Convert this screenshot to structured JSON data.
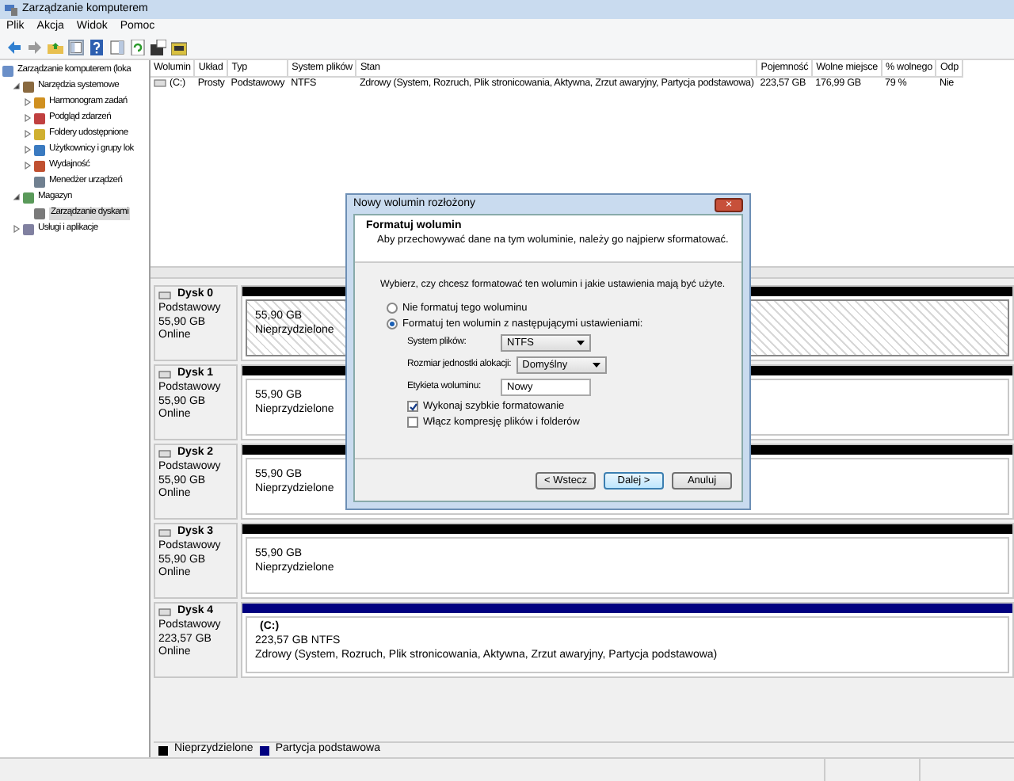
{
  "window": {
    "title": "Zarządzanie komputerem"
  },
  "menu": [
    "Plik",
    "Akcja",
    "Widok",
    "Pomoc"
  ],
  "tree": [
    {
      "label": "Zarządzanie komputerem (loka",
      "kind": "root",
      "selected": false,
      "children": [
        {
          "label": "Narzędzia systemowe",
          "kind": "branch",
          "expanded": true,
          "selected": false,
          "children": [
            {
              "label": "Harmonogram zadań",
              "kind": "branch",
              "expanded": false,
              "selected": false
            },
            {
              "label": "Podgląd zdarzeń",
              "kind": "branch",
              "expanded": false,
              "selected": false
            },
            {
              "label": "Foldery udostępnione",
              "kind": "branch",
              "expanded": false,
              "selected": false
            },
            {
              "label": "Użytkownicy i grupy lok",
              "kind": "branch",
              "expanded": false,
              "selected": false
            },
            {
              "label": "Wydajność",
              "kind": "branch",
              "expanded": false,
              "selected": false
            },
            {
              "label": "Menedżer urządzeń",
              "kind": "leaf",
              "selected": false
            }
          ]
        },
        {
          "label": "Magazyn",
          "kind": "branch",
          "expanded": true,
          "selected": false,
          "children": [
            {
              "label": "Zarządzanie dyskami",
              "kind": "leaf",
              "selected": true
            }
          ]
        },
        {
          "label": "Usługi i aplikacje",
          "kind": "branch",
          "expanded": false,
          "selected": false
        }
      ]
    }
  ],
  "table": {
    "columns": [
      "Wolumin",
      "Układ",
      "Typ",
      "System plików",
      "Stan",
      "Pojemność",
      "Wolne miejsce",
      "% wolnego",
      "Odp"
    ],
    "rows": [
      [
        "(C:)",
        "Prosty",
        "Podstawowy",
        "NTFS",
        "Zdrowy (System, Rozruch, Plik stronicowania, Aktywna, Zrzut awaryjny, Partycja podstawowa)",
        "223,57 GB",
        "176,99 GB",
        "79 %",
        "Nie"
      ]
    ]
  },
  "disks": [
    {
      "name": "Dysk 0",
      "type": "Podstawowy",
      "size": "55,90 GB",
      "status": "Online",
      "partition": {
        "color": "#000000",
        "selected": true,
        "lines": [
          "55,90 GB",
          "Nieprzydzielone"
        ]
      }
    },
    {
      "name": "Dysk 1",
      "type": "Podstawowy",
      "size": "55,90 GB",
      "status": "Online",
      "partition": {
        "color": "#000000",
        "selected": false,
        "lines": [
          "55,90 GB",
          "Nieprzydzielone"
        ]
      }
    },
    {
      "name": "Dysk 2",
      "type": "Podstawowy",
      "size": "55,90 GB",
      "status": "Online",
      "partition": {
        "color": "#000000",
        "selected": false,
        "lines": [
          "55,90 GB",
          "Nieprzydzielone"
        ]
      }
    },
    {
      "name": "Dysk 3",
      "type": "Podstawowy",
      "size": "55,90 GB",
      "status": "Online",
      "partition": {
        "color": "#000000",
        "selected": false,
        "lines": [
          "55,90 GB",
          "Nieprzydzielone"
        ]
      }
    },
    {
      "name": "Dysk 4",
      "type": "Podstawowy",
      "size": "223,57 GB",
      "status": "Online",
      "partition": {
        "color": "#000080",
        "selected": false,
        "title": "(C:)",
        "lines": [
          "223,57 GB NTFS",
          "Zdrowy (System, Rozruch, Plik stronicowania, Aktywna, Zrzut awaryjny, Partycja podstawowa)"
        ]
      }
    }
  ],
  "legend": [
    {
      "label": "Nieprzydzielone",
      "color": "#000000"
    },
    {
      "label": "Partycja podstawowa",
      "color": "#000080"
    }
  ],
  "dialog": {
    "title": "Nowy wolumin rozłożony",
    "close": "×",
    "heading": "Formatuj wolumin",
    "subheading": "Aby przechowywać dane na tym woluminie, należy go najpierw sformatować.",
    "prompt": "Wybierz, czy chcesz formatować ten wolumin i jakie ustawienia mają być użyte.",
    "options": [
      {
        "label": "Nie formatuj tego woluminu",
        "selected": false
      },
      {
        "label": "Formatuj ten wolumin z następującymi ustawieniami:",
        "selected": true
      }
    ],
    "fields": [
      {
        "label": "System plików:",
        "kind": "select",
        "value": "NTFS"
      },
      {
        "label": "Rozmiar jednostki alokacji:",
        "kind": "select",
        "value": "Domyślny"
      },
      {
        "label": "Etykieta woluminu:",
        "kind": "text",
        "value": "Nowy"
      }
    ],
    "checkboxes": [
      {
        "label": "Wykonaj szybkie formatowanie",
        "checked": true
      },
      {
        "label": "Włącz kompresję plików i folderów",
        "checked": false
      }
    ],
    "buttons": [
      {
        "label": "< Wstecz",
        "default": false
      },
      {
        "label": "Dalej >",
        "default": true
      },
      {
        "label": "Anuluj",
        "default": false
      }
    ]
  }
}
